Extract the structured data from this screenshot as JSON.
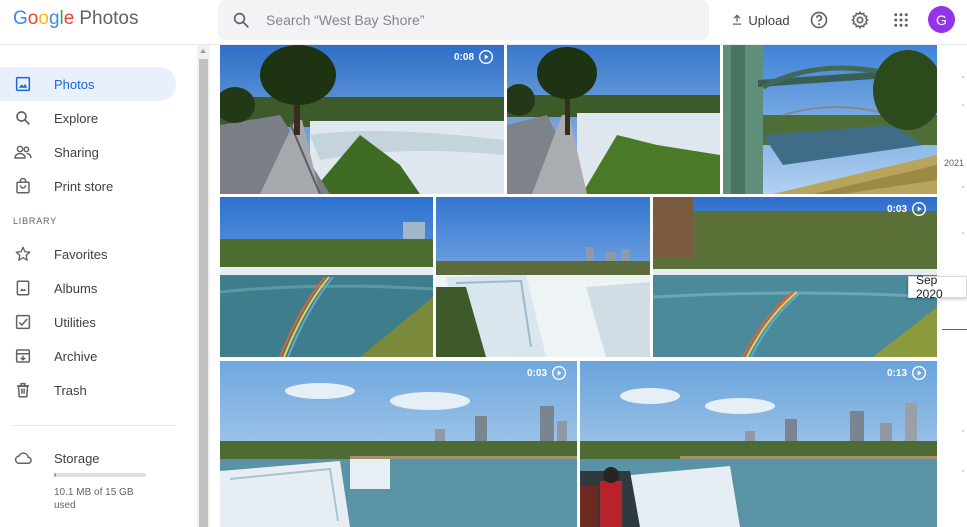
{
  "header": {
    "logo_google": "Google",
    "logo_photos": "Photos",
    "search_placeholder": "Search “West Bay Shore”",
    "upload_label": "Upload",
    "avatar_letter": "G"
  },
  "colors": {
    "accent": "#1a73e8",
    "active_nav_bg": "#e8f0fe",
    "avatar": "#9334e6"
  },
  "sidebar": {
    "items": [
      {
        "label": "Photos",
        "icon": "photo-icon",
        "active": true
      },
      {
        "label": "Explore",
        "icon": "search-icon"
      },
      {
        "label": "Sharing",
        "icon": "people-icon"
      },
      {
        "label": "Print store",
        "icon": "shopping-bag-icon"
      }
    ],
    "library_heading": "LIBRARY",
    "library_items": [
      {
        "label": "Favorites",
        "icon": "star-icon"
      },
      {
        "label": "Albums",
        "icon": "album-icon"
      },
      {
        "label": "Utilities",
        "icon": "checklist-icon"
      },
      {
        "label": "Archive",
        "icon": "archive-icon"
      },
      {
        "label": "Trash",
        "icon": "trash-icon"
      }
    ],
    "storage": {
      "label": "Storage",
      "icon": "cloud-icon",
      "used_text": "10.1 MB of 15 GB used",
      "used_fraction": 0.0007
    }
  },
  "photos": [
    {
      "description": "River rapids with walkway and tree",
      "duration": "0:08",
      "is_video": true
    },
    {
      "description": "Walkway along river rapids",
      "is_video": false
    },
    {
      "description": "Rainbow bridge over river",
      "is_video": false
    },
    {
      "description": "Falls with rainbow",
      "is_video": false
    },
    {
      "description": "Horseshoe falls with mist",
      "is_video": false
    },
    {
      "description": "Gorge with rainbow",
      "duration": "0:03",
      "is_video": true
    },
    {
      "description": "Falls with city skyline",
      "duration": "0:03",
      "is_video": true
    },
    {
      "description": "Falls with skyline and people",
      "duration": "0:13",
      "is_video": true
    }
  ],
  "timeline": {
    "year": "2021",
    "current_date": "Sep 2020"
  }
}
